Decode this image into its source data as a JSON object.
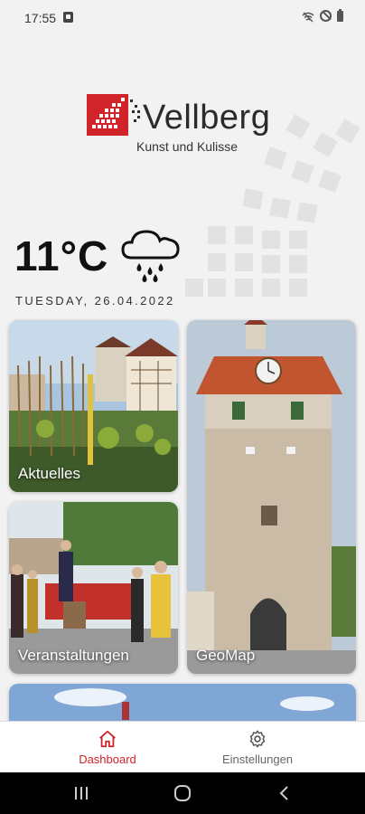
{
  "status": {
    "time": "17:55"
  },
  "logo": {
    "brand": "Vellberg",
    "tagline": "Kunst und Kulisse"
  },
  "weather": {
    "temperature": "11°C",
    "icon": "rain-cloud-icon",
    "date": "TUESDAY, 26.04.2022"
  },
  "tiles": [
    {
      "label": "Aktuelles"
    },
    {
      "label": "Veranstaltungen"
    },
    {
      "label": "GeoMap"
    }
  ],
  "nav": {
    "items": [
      {
        "label": "Dashboard",
        "icon": "home-icon",
        "active": true
      },
      {
        "label": "Einstellungen",
        "icon": "gear-icon",
        "active": false
      }
    ]
  },
  "colors": {
    "accent": "#d1232a",
    "background": "#f2f2f2"
  }
}
